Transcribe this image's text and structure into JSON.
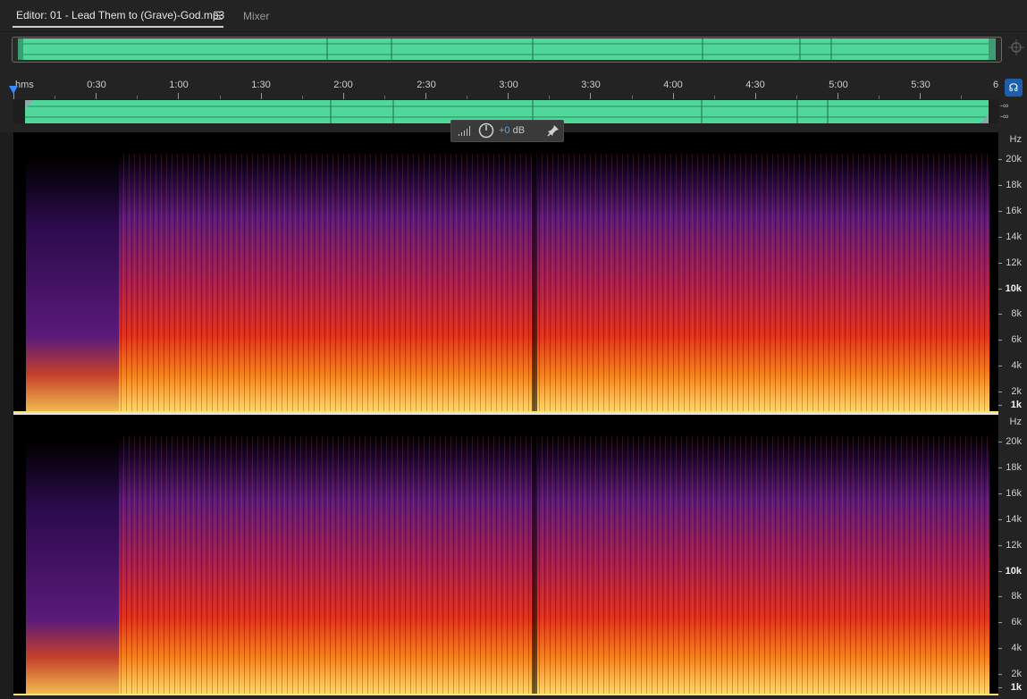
{
  "tabs": {
    "editor_label": "Editor: 01 - Lead Them to (Grave)-God.mp3",
    "menu_icon": "hamburger-menu-icon",
    "mixer_label": "Mixer"
  },
  "ruler": {
    "unit": "hms",
    "labels": [
      "0:30",
      "1:00",
      "1:30",
      "2:00",
      "2:30",
      "3:00",
      "3:30",
      "4:00",
      "4:30",
      "5:00",
      "5:30",
      "6"
    ]
  },
  "channels": {
    "inf_top": "-∞",
    "inf_bottom": "-∞"
  },
  "hud": {
    "gain_value": "+0",
    "gain_unit": " dB"
  },
  "spectrum": {
    "unit": "Hz",
    "labels": [
      "20k",
      "18k",
      "16k",
      "14k",
      "12k",
      "10k",
      "8k",
      "6k",
      "4k",
      "2k",
      "1k"
    ]
  },
  "colors": {
    "waveform": "#4fd89a",
    "accent": "#3a8bff",
    "spec_low": "#ffe070",
    "spec_mid": "#e0301e",
    "spec_high": "#5a1a7a"
  }
}
